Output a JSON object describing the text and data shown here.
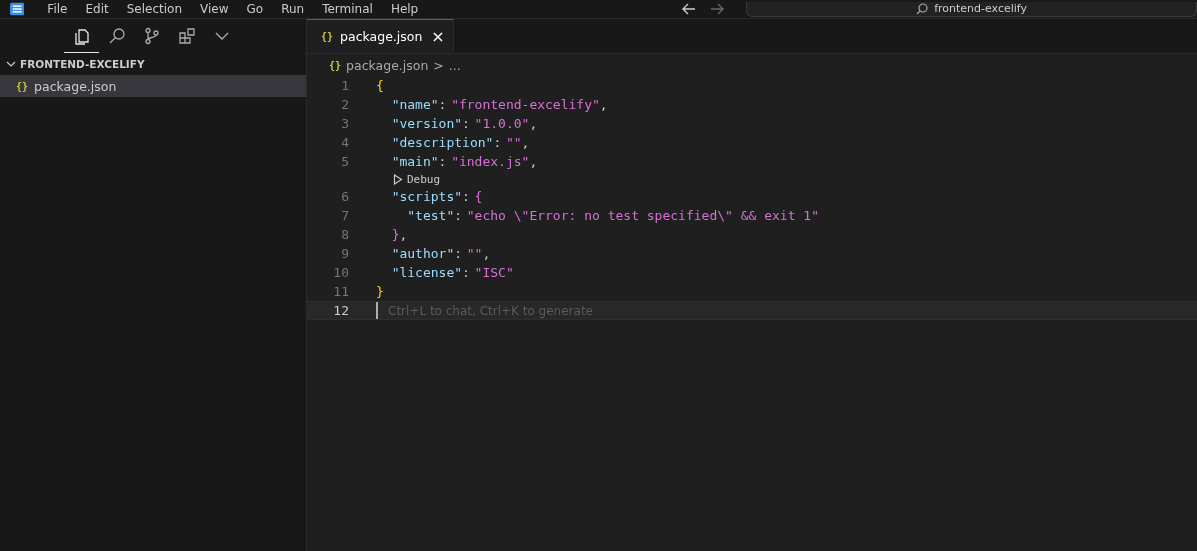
{
  "title_bar": {
    "menus": [
      "File",
      "Edit",
      "Selection",
      "View",
      "Go",
      "Run",
      "Terminal",
      "Help"
    ],
    "command_center": "frontend-excelify"
  },
  "activity_bar": {
    "items": [
      {
        "kind": "files",
        "selected": true
      },
      {
        "kind": "search",
        "selected": false
      },
      {
        "kind": "source-control",
        "selected": false
      },
      {
        "kind": "extensions",
        "selected": false
      },
      {
        "kind": "more",
        "selected": false
      }
    ]
  },
  "explorer": {
    "folder": {
      "label": "FRONTEND-EXCELIFY",
      "expanded": true
    },
    "files": [
      {
        "icon": "{}",
        "label": "package.json",
        "selected": true
      }
    ]
  },
  "tabs": [
    {
      "icon": "{}",
      "label": "package.json",
      "close": "×",
      "selected": true
    }
  ],
  "breadcrumb": {
    "icon": "{}",
    "label": "package.json",
    "separator": ">",
    "more": "..."
  },
  "editor": {
    "lines": [
      {
        "kind": "code",
        "number": "1",
        "current": false,
        "tokens": [
          {
            "kind": "open",
            "text": "{"
          }
        ]
      },
      {
        "kind": "code",
        "number": "2",
        "current": false,
        "tokens": [
          {
            "kind": "key",
            "text": "\"name\""
          },
          {
            "kind": "punct",
            "text": ":"
          },
          {
            "kind": "string",
            "text": "\"frontend-excelify\""
          },
          {
            "kind": "punct",
            "text": ","
          }
        ]
      },
      {
        "kind": "code",
        "number": "3",
        "current": false,
        "tokens": [
          {
            "kind": "key",
            "text": "\"version\""
          },
          {
            "kind": "punct",
            "text": ":"
          },
          {
            "kind": "string",
            "text": "\"1.0.0\""
          },
          {
            "kind": "punct",
            "text": ","
          }
        ]
      },
      {
        "kind": "code",
        "number": "4",
        "current": false,
        "tokens": [
          {
            "kind": "key",
            "text": "\"description\""
          },
          {
            "kind": "punct",
            "text": ":"
          },
          {
            "kind": "string",
            "text": "\"\""
          },
          {
            "kind": "punct",
            "text": ","
          }
        ]
      },
      {
        "kind": "code",
        "number": "5",
        "current": false,
        "tokens": [
          {
            "kind": "key",
            "text": "\"main\""
          },
          {
            "kind": "punct",
            "text": ":"
          },
          {
            "kind": "string",
            "text": "\"index.js\""
          },
          {
            "kind": "punct",
            "text": ","
          }
        ]
      },
      {
        "kind": "codelens",
        "label": "Debug"
      },
      {
        "kind": "code",
        "number": "6",
        "current": false,
        "tokens": [
          {
            "kind": "key",
            "text": "\"scripts\""
          },
          {
            "kind": "punct",
            "text": ":"
          },
          {
            "kind": "open",
            "text": "{"
          }
        ]
      },
      {
        "kind": "code",
        "number": "7",
        "current": false,
        "tokens": [
          {
            "kind": "key",
            "text": "\"test\""
          },
          {
            "kind": "punct",
            "text": ":"
          },
          {
            "kind": "string",
            "text": "\"echo \\\"Error: no test specified\\\" && exit 1\""
          }
        ]
      },
      {
        "kind": "code",
        "number": "8",
        "current": false,
        "tokens": [
          {
            "kind": "close",
            "text": "}"
          },
          {
            "kind": "punct",
            "text": ","
          }
        ]
      },
      {
        "kind": "code",
        "number": "9",
        "current": false,
        "tokens": [
          {
            "kind": "key",
            "text": "\"author\""
          },
          {
            "kind": "punct",
            "text": ":"
          },
          {
            "kind": "string",
            "text": "\"\""
          },
          {
            "kind": "punct",
            "text": ","
          }
        ]
      },
      {
        "kind": "code",
        "number": "10",
        "current": false,
        "tokens": [
          {
            "kind": "key",
            "text": "\"license\""
          },
          {
            "kind": "punct",
            "text": ":"
          },
          {
            "kind": "string",
            "text": "\"ISC\""
          }
        ]
      },
      {
        "kind": "code",
        "number": "11",
        "current": false,
        "tokens": [
          {
            "kind": "close",
            "text": "}"
          }
        ]
      },
      {
        "kind": "code",
        "number": "12",
        "current": true,
        "placeholder": "Ctrl+L to chat, Ctrl+K to generate"
      }
    ]
  }
}
